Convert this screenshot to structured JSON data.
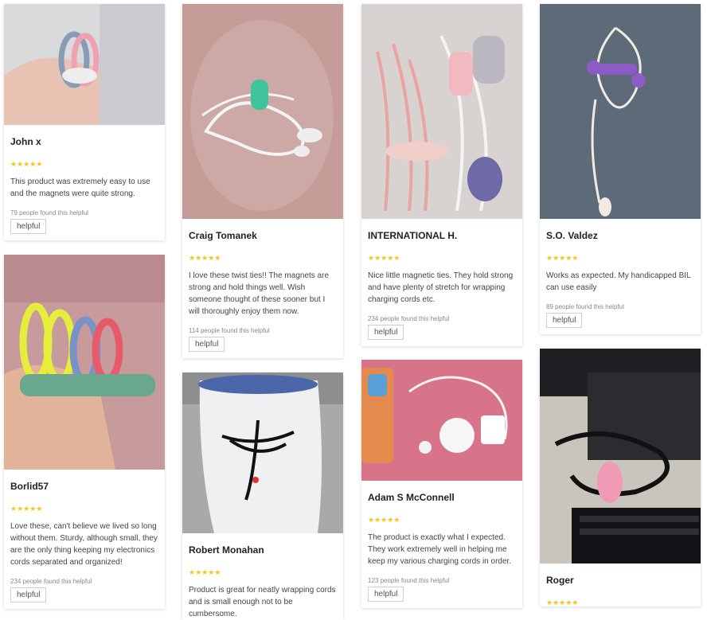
{
  "reviews": [
    {
      "name": "John x",
      "stars": "★★★★★",
      "text": "This product was extremely easy to use and the magnets were quite strong.",
      "helpful_count": "79 people found this helpful",
      "helpful_label": "helpful"
    },
    {
      "name": "Craig Tomanek",
      "stars": "★★★★★",
      "text": "I love these twist ties!! The magnets are strong and hold things well. Wish someone thought of these sooner but I will thoroughly enjoy them now.",
      "helpful_count": "114 people found this helpful",
      "helpful_label": "helpful"
    },
    {
      "name": "INTERNATIONAL H.",
      "stars": "★★★★★",
      "text": "Nice little magnetic ties. They hold strong and have plenty of stretch for wrapping charging cords etc.",
      "helpful_count": "234 people found this helpful",
      "helpful_label": "helpful"
    },
    {
      "name": "S.O. Valdez",
      "stars": "★★★★★",
      "text": "Works as expected. My handicapped BIL can use easily",
      "helpful_count": "89 people found this helpful",
      "helpful_label": "helpful"
    },
    {
      "name": "Borlid57",
      "stars": "★★★★★",
      "text": "Love these, can't believe we lived so long without them. Sturdy, although small, they are the only thing keeping my electronics cords separated and organized!",
      "helpful_count": "234 people found this helpful",
      "helpful_label": "helpful"
    },
    {
      "name": "Robert Monahan",
      "stars": "★★★★★",
      "text": "Product is great for neatly wrapping cords and is small enough not to be cumbersome.",
      "helpful_count": "",
      "helpful_label": ""
    },
    {
      "name": "Adam S McConnell",
      "stars": "★★★★★",
      "text": "The product is exactly what I expected. They work extremely well in helping me keep my various charging cords in order.",
      "helpful_count": "123 people found this helpful",
      "helpful_label": "helpful"
    },
    {
      "name": "Roger",
      "stars": "★★★★★",
      "text": "",
      "helpful_count": "",
      "helpful_label": ""
    }
  ],
  "colors": {
    "star": "#f5c518",
    "card_bg": "#ffffff",
    "border": "#cfcfcf"
  }
}
